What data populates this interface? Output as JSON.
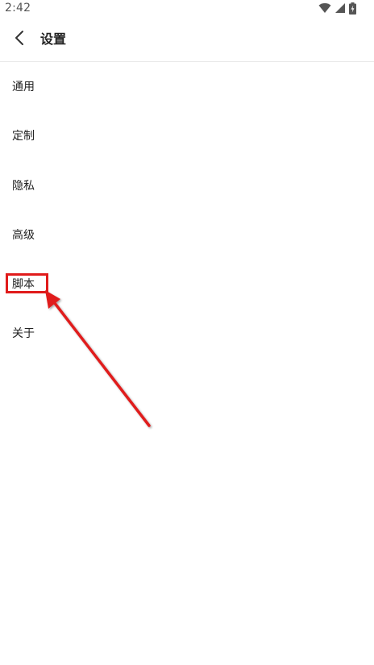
{
  "status_bar": {
    "time": "2:42",
    "icons": [
      "wifi-icon",
      "signal-icon",
      "battery-charging-icon"
    ]
  },
  "header": {
    "back_icon": "chevron-left-icon",
    "title": "设置"
  },
  "settings": {
    "items": [
      {
        "label": "通用"
      },
      {
        "label": "定制"
      },
      {
        "label": "隐私"
      },
      {
        "label": "高级"
      },
      {
        "label": "脚本"
      },
      {
        "label": "关于"
      }
    ]
  },
  "annotation": {
    "highlighted_item": "脚本",
    "color": "#e01b1b"
  }
}
